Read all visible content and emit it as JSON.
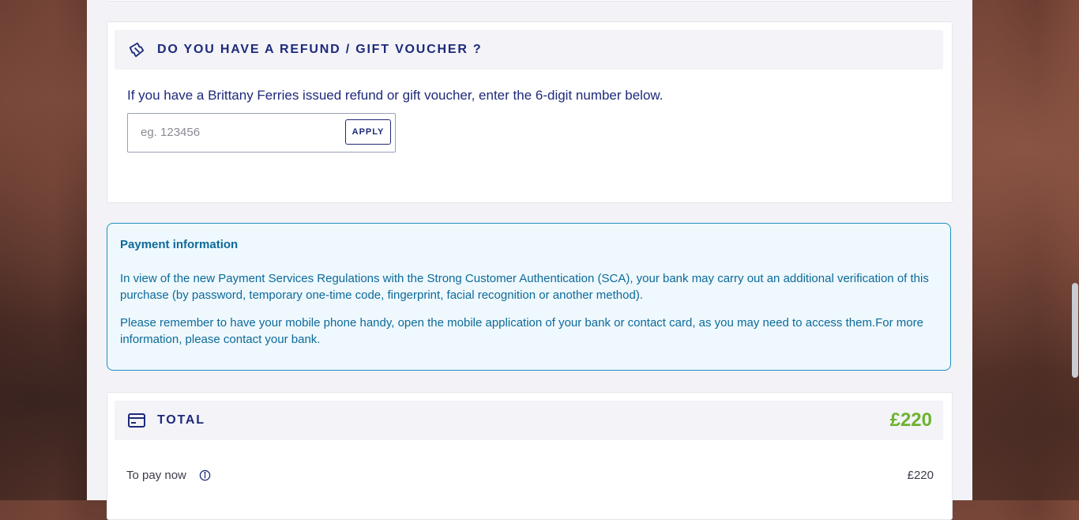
{
  "voucher": {
    "title": "DO YOU HAVE A REFUND / GIFT VOUCHER ?",
    "description": "If you have a Brittany Ferries issued refund or gift voucher, enter the 6-digit number below.",
    "input_placeholder": "eg. 123456",
    "input_value": "",
    "apply_label": "APPLY",
    "icon": "ticket-icon"
  },
  "payment_info": {
    "title": "Payment information",
    "paragraph1": "In view of the new Payment Services Regulations with the Strong Customer Authentication (SCA), your bank may carry out an additional verification of this purchase (by password, temporary one-time code, fingerprint, facial recognition or another method).",
    "paragraph2": "Please remember to have your mobile phone handy, open the mobile application of your bank or contact card, as you may need to access them.For more information, please contact your bank."
  },
  "total": {
    "title": "TOTAL",
    "amount": "£220",
    "icon": "credit-card-icon",
    "pay_now_label": "To pay now",
    "pay_now_amount": "£220"
  },
  "colors": {
    "brand_navy": "#1e2a7a",
    "total_green": "#6db32f",
    "info_blue": "#0d6a9a",
    "info_border": "#1d8fc0"
  }
}
